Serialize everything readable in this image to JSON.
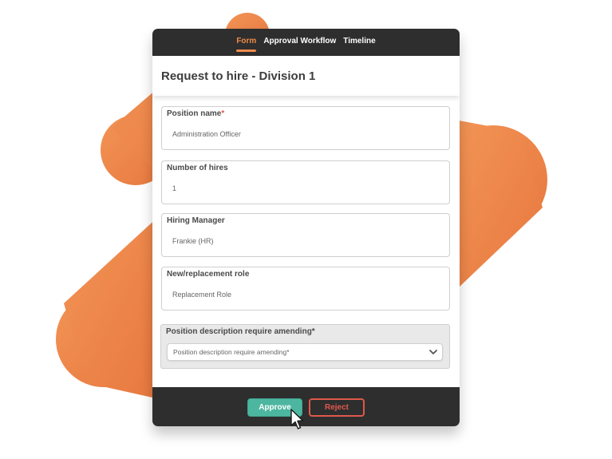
{
  "tabs": [
    {
      "label": "Form",
      "active": true
    },
    {
      "label": "Approval Workflow",
      "active": false
    },
    {
      "label": "Timeline",
      "active": false
    }
  ],
  "header": {
    "title": "Request to hire - Division 1"
  },
  "fields": [
    {
      "label": "Position name",
      "required_mark": "*",
      "value": "Administration Officer"
    },
    {
      "label": "Number of hires",
      "required_mark": "",
      "value": "1"
    },
    {
      "label": "Hiring Manager",
      "required_mark": "",
      "value": "Frankie (HR)"
    },
    {
      "label": "New/replacement role",
      "required_mark": "",
      "value": "Replacement Role"
    }
  ],
  "select": {
    "label": "Position description require amending*",
    "value": "Position description require amending*"
  },
  "actions": {
    "approve_label": "Approve",
    "reject_label": "Reject"
  },
  "icons": {
    "dropdown": "chevron-down-icon",
    "cursor": "mouse-pointer-icon"
  },
  "colors": {
    "accent": "#f08a49",
    "dark_bar": "#2e2e2e",
    "approve": "#4db6a0",
    "reject": "#e0584b"
  }
}
